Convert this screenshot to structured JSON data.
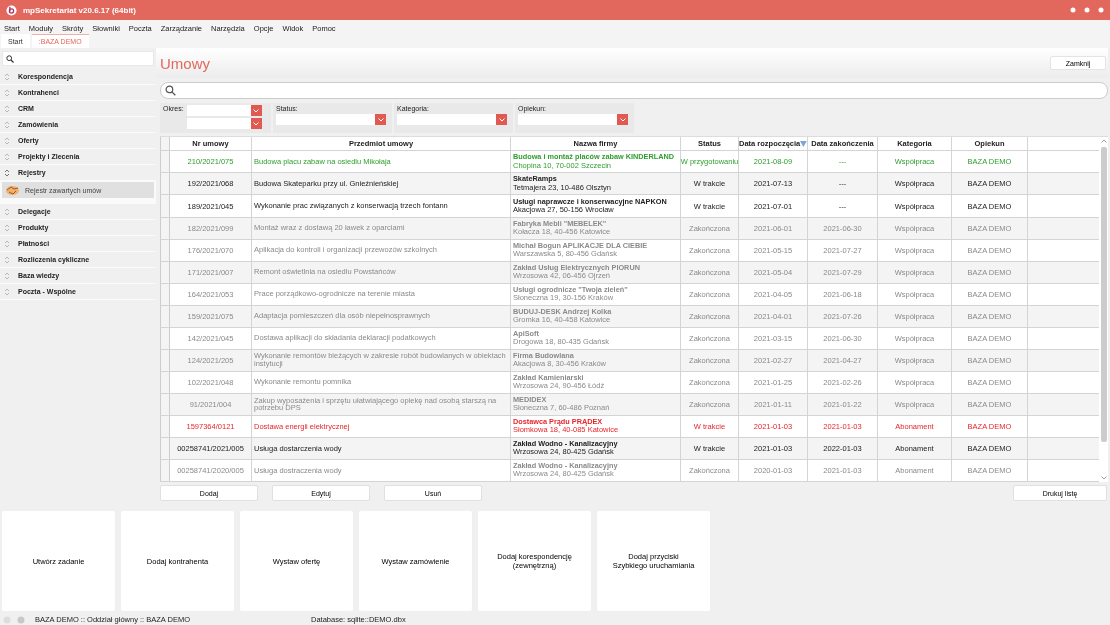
{
  "window": {
    "title": "mpSekretariat v20.6.17 (64bit)"
  },
  "menu": [
    "Start",
    "Moduły",
    "Skróty",
    "Słowniki",
    "Poczta",
    "Zarządzanie",
    "Narzędzia",
    "Opcje",
    "Widok",
    "Pomoc"
  ],
  "tabs": [
    {
      "label": "Start",
      "selected": false
    },
    {
      "label": ":BAZA DEMO",
      "selected": true
    }
  ],
  "sidebar": {
    "items": [
      {
        "label": "Korespondencja",
        "expanded": false
      },
      {
        "label": "Kontrahenci",
        "expanded": false
      },
      {
        "label": "CRM",
        "expanded": false
      },
      {
        "label": "Zamówienia",
        "expanded": false
      },
      {
        "label": "Oferty",
        "expanded": false
      },
      {
        "label": "Projekty i Zlecenia",
        "expanded": false
      },
      {
        "label": "Rejestry",
        "expanded": true,
        "children": [
          {
            "label": "Rejestr zawartych umów",
            "selected": true
          }
        ]
      },
      {
        "label": "Delegacje",
        "expanded": false
      },
      {
        "label": "Produkty",
        "expanded": false
      },
      {
        "label": "Płatności",
        "expanded": false
      },
      {
        "label": "Rozliczenia cykliczne",
        "expanded": false
      },
      {
        "label": "Baza wiedzy",
        "expanded": false
      },
      {
        "label": "Poczta - Wspólne",
        "expanded": false
      }
    ]
  },
  "page": {
    "title": "Umowy",
    "close_button": "Zamknij"
  },
  "filters": [
    {
      "label": "Okres:",
      "kind": "range"
    },
    {
      "label": "Status:",
      "kind": "single"
    },
    {
      "label": "Kategoria:",
      "kind": "single"
    },
    {
      "label": "Opiekun:",
      "kind": "single"
    }
  ],
  "table": {
    "columns": [
      {
        "label": "Nr umowy",
        "sorted": false
      },
      {
        "label": "Przedmiot umowy",
        "sorted": false
      },
      {
        "label": "Nazwa firmy",
        "sorted": false
      },
      {
        "label": "Status",
        "sorted": false
      },
      {
        "label": "Data rozpoczęcia",
        "sorted": true
      },
      {
        "label": "Data zakończenia",
        "sorted": false
      },
      {
        "label": "Kategoria",
        "sorted": false
      },
      {
        "label": "Opiekun",
        "sorted": false
      }
    ],
    "rows": [
      {
        "color": "#2e9e2e",
        "nr": "210/2021/075",
        "subject": "Budowa placu zabaw na osiedlu Mikołaja",
        "company": "Budowa i montaż placów zabaw KINDERLAND",
        "address": "Chopina 10, 70-002 Szczecin",
        "status": "W przygotowaniu",
        "start": "2021-08-09",
        "end": "---",
        "category": "Współpraca",
        "owner": "BAZA DEMO"
      },
      {
        "color": "#222222",
        "nr": "192/2021/068",
        "subject": "Budowa Skateparku przy ul. Gnieźnieńskiej",
        "company": "SkateRamps",
        "address": "Tetmajera 23, 10-486 Olsztyn",
        "status": "W trakcie",
        "start": "2021-07-13",
        "end": "---",
        "category": "Współpraca",
        "owner": "BAZA DEMO"
      },
      {
        "color": "#222222",
        "nr": "189/2021/045",
        "subject": "Wykonanie prac związanych z konserwacją trzech fontann",
        "company": "Usługi naprawcze i konserwacyjne NAPKON",
        "address": "Akacjowa 27, 50-156 Wrocław",
        "status": "W trakcie",
        "start": "2021-07-01",
        "end": "---",
        "category": "Współpraca",
        "owner": "BAZA DEMO"
      },
      {
        "color": "#8a8a8a",
        "nr": "182/2021/099",
        "subject": "Montaż wraz z dostawą 20 ławek z oparciami",
        "company": "Fabryka Mebli \"MEBELEK\"",
        "address": "Kołacza 18, 40-456 Katowice",
        "status": "Zakończona",
        "start": "2021-06-01",
        "end": "2021-06-30",
        "category": "Współpraca",
        "owner": "BAZA DEMO"
      },
      {
        "color": "#8a8a8a",
        "nr": "176/2021/070",
        "subject": "Aplikacja do kontroli i organizacji przewozów szkolnych",
        "company": "Michał Bogun APLIKACJE DLA CIEBIE",
        "address": "Warszawska 5, 80-456 Gdańsk",
        "status": "Zakończona",
        "start": "2021-05-15",
        "end": "2021-07-27",
        "category": "Współpraca",
        "owner": "BAZA DEMO"
      },
      {
        "color": "#8a8a8a",
        "nr": "171/2021/007",
        "subject": "Remont oświetlnia na osiedlu Powstańców",
        "company": "Zakład Usług Elektrycznych PIORUN",
        "address": "Wrzosowa 42, 06-456 Ojrzeń",
        "status": "Zakończona",
        "start": "2021-05-04",
        "end": "2021-07-29",
        "category": "Współpraca",
        "owner": "BAZA DEMO"
      },
      {
        "color": "#8a8a8a",
        "nr": "164/2021/053",
        "subject": "Prace porządkowo-ogrodnicze na terenie miasta",
        "company": "Usługi ogrodnicze \"Twoja zieleń\"",
        "address": "Słoneczna 19, 30-156 Kraków",
        "status": "Zakończona",
        "start": "2021-04-05",
        "end": "2021-06-18",
        "category": "Współpraca",
        "owner": "BAZA DEMO"
      },
      {
        "color": "#8a8a8a",
        "nr": "159/2021/075",
        "subject": "Adaptacja pomieszczeń dla osób niepełnosprawnych",
        "company": "BUDUJ-DESK Andrzej Kolka",
        "address": "Gromka 16, 40-458 Katowice",
        "status": "Zakończona",
        "start": "2021-04-01",
        "end": "2021-07-26",
        "category": "Współpraca",
        "owner": "BAZA DEMO"
      },
      {
        "color": "#8a8a8a",
        "nr": "142/2021/045",
        "subject": "Dostawa aplikacji do składania deklaracji podatkowych",
        "company": "ApiSoft",
        "address": "Drogowa 18, 80-435 Gdańsk",
        "status": "Zakończona",
        "start": "2021-03-15",
        "end": "2021-06-30",
        "category": "Współpraca",
        "owner": "BAZA DEMO"
      },
      {
        "color": "#8a8a8a",
        "nr": "124/2021/205",
        "subject": "Wykonanie remontów bieżących w zakresie robót budowlanych w obiektach instytucji",
        "company": "Firma Budowlana",
        "address": "Akacjowa 8, 30-456 Kraków",
        "status": "Zakończona",
        "start": "2021-02-27",
        "end": "2021-04-27",
        "category": "Współpraca",
        "owner": "BAZA DEMO"
      },
      {
        "color": "#8a8a8a",
        "nr": "102/2021/048",
        "subject": "Wykonanie remontu pomnika",
        "company": "Zakład Kamieniarski",
        "address": "Wrzosowa 24, 90-456 Łódź",
        "status": "Zakończona",
        "start": "2021-01-25",
        "end": "2021-02-26",
        "category": "Współpraca",
        "owner": "BAZA DEMO"
      },
      {
        "color": "#8a8a8a",
        "nr": "91/2021/004",
        "subject": "Zakup wyposażenia i sprzętu ułatwiającego opiekę nad osobą starszą na potrzebu DPS",
        "company": "MEDIDEX",
        "address": "Słoneczna 7, 60-486 Poznań",
        "status": "Zakończona",
        "start": "2021-01-11",
        "end": "2021-01-22",
        "category": "Współpraca",
        "owner": "BAZA DEMO"
      },
      {
        "color": "#e8262a",
        "nr": "1597364/0121",
        "subject": "Dostawa energii elektrycznej",
        "company": "Dostawca Prądu PRĄDEX",
        "address": "Słomkowa 18, 40-085 Katowice",
        "status": "W trakcie",
        "start": "2021-01-03",
        "end": "2021-01-03",
        "category": "Abonament",
        "owner": "BAZA DEMO"
      },
      {
        "color": "#222222",
        "nr": "00258741/2021/005",
        "subject": "Usługa dostarczenia wody",
        "company": "Zakład Wodno - Kanalizacyjny",
        "address": "Wrzosowa 24, 80-425 Gdańsk",
        "status": "W trakcie",
        "start": "2021-01-03",
        "end": "2022-01-03",
        "category": "Abonament",
        "owner": "BAZA DEMO"
      },
      {
        "color": "#8a8a8a",
        "nr": "00258741/2020/005",
        "subject": "Usługa dostraczenia wody",
        "company": "Zakład Wodno - Kanalizacyjny",
        "address": "Wrzosowa 24, 80-425 Gdańsk",
        "status": "Zakończona",
        "start": "2020-01-03",
        "end": "2021-01-03",
        "category": "Abonament",
        "owner": "BAZA DEMO"
      }
    ]
  },
  "actions": [
    "Dodaj",
    "Edytuj",
    "Usuń"
  ],
  "print_button": "Drukuj listę",
  "quick_tiles": [
    "Utwórz zadanie",
    "Dodaj kontrahenta",
    "Wystaw ofertę",
    "Wystaw zamówienie",
    "Dodaj korespondencję\n(zewnętrzną)",
    "Dodaj przyciski\nSzybkiego uruchamiania"
  ],
  "status_bar": {
    "branch": "BAZA DEMO :: Oddział główny :: BAZA DEMO",
    "database": "Database: sqlite::DEMO.dbx"
  }
}
